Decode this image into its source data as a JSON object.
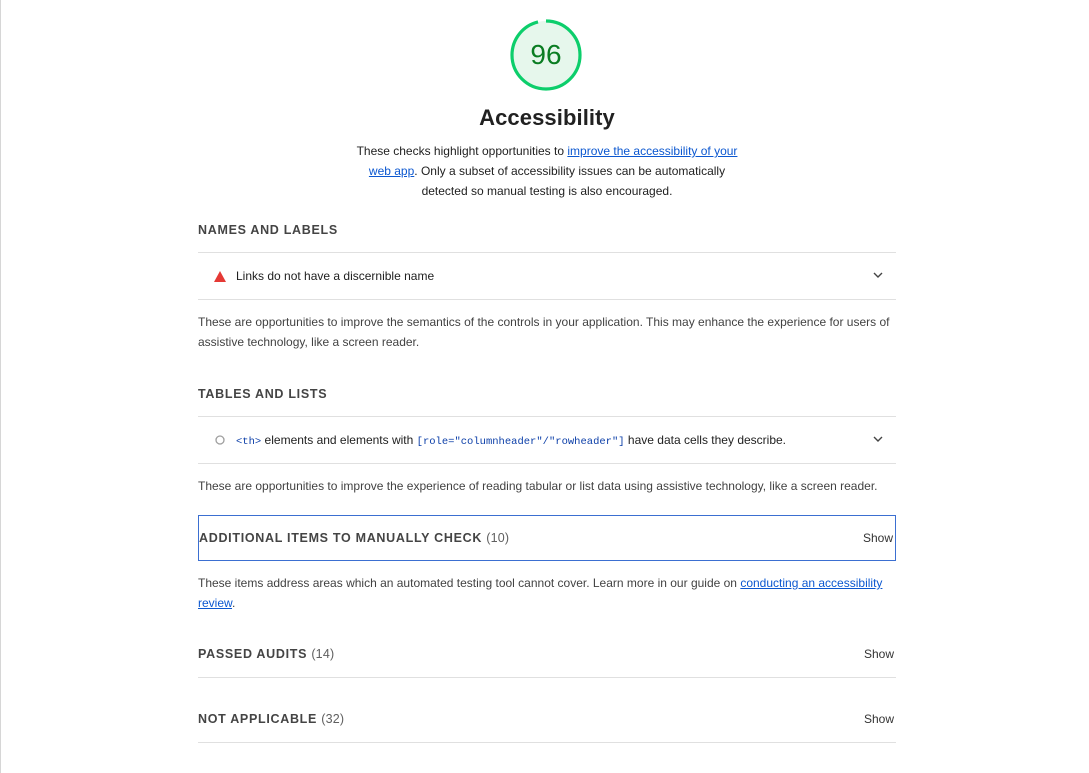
{
  "score": {
    "value": "96",
    "color": "#0cce6b",
    "text_color": "#0a7d22"
  },
  "category": {
    "title": "Accessibility",
    "desc_before": "These checks highlight opportunities to ",
    "desc_link": "improve the accessibility of your web app",
    "desc_after": ". Only a subset of accessibility issues can be automatically detected so manual testing is also encouraged."
  },
  "groups": {
    "names_labels": {
      "title": "Names and Labels",
      "audit": {
        "icon": "fail-triangle-icon",
        "text": "Links do not have a discernible name"
      },
      "description": "These are opportunities to improve the semantics of the controls in your application. This may enhance the experience for users of assistive technology, like a screen reader."
    },
    "tables_lists": {
      "title": "Tables and Lists",
      "audit": {
        "icon": "not-applicable-circle-icon",
        "code1": "<th>",
        "text_mid": " elements and elements with ",
        "code2": "[role=\"columnheader\"/\"rowheader\"]",
        "text_end": " have data cells they describe."
      },
      "description": "These are opportunities to improve the experience of reading tabular or list data using assistive technology, like a screen reader."
    },
    "manual": {
      "title": "Additional items to manually check",
      "count": "(10)",
      "show": "Show",
      "desc_before": "These items address areas which an automated testing tool cannot cover. Learn more in our guide on ",
      "desc_link": "conducting an accessibility review",
      "desc_after": "."
    },
    "passed": {
      "title": "Passed audits",
      "count": "(14)",
      "show": "Show"
    },
    "not_applicable": {
      "title": "Not applicable",
      "count": "(32)",
      "show": "Show"
    }
  },
  "colors": {
    "fail": "#e53935",
    "link": "#0b57d0",
    "focus": "#3b6fd1"
  }
}
